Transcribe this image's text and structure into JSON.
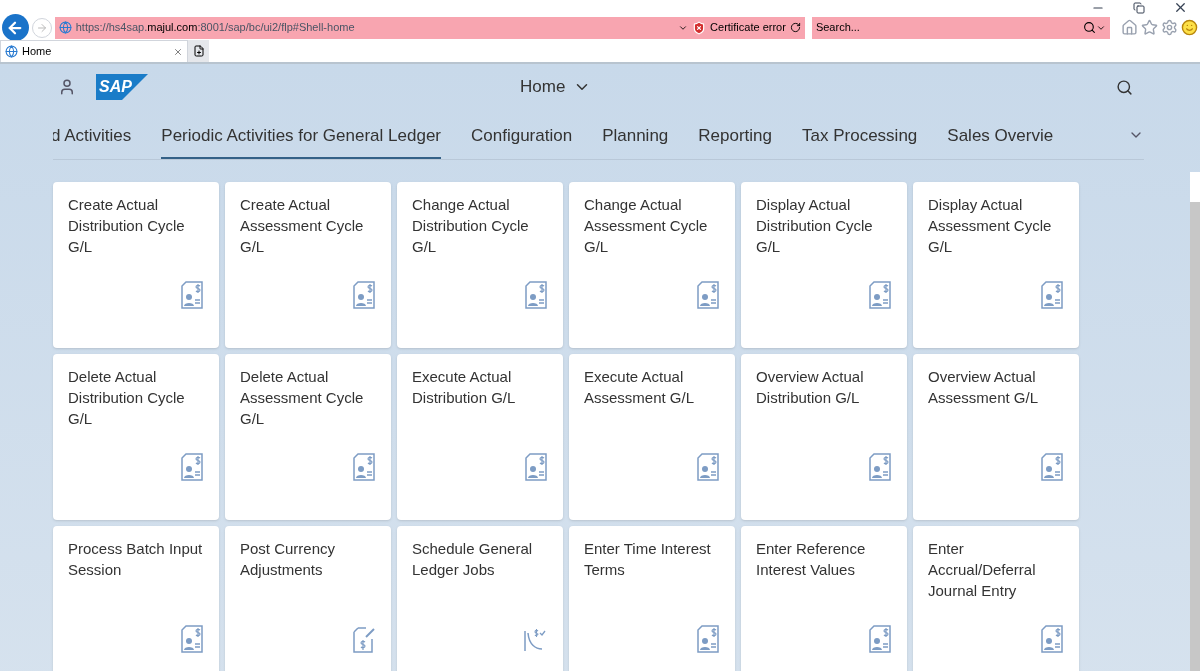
{
  "browser": {
    "url_prefix": "https://hs4sap.",
    "url_domain": "majul.com",
    "url_suffix": ":8001/sap/bc/ui2/flp#Shell-home",
    "certificate": "Certificate error",
    "search_placeholder": "Search...",
    "tab": "Home"
  },
  "shell": {
    "logo": "SAP",
    "title": "Home"
  },
  "tabs": [
    {
      "label": "d Activities",
      "selected": false
    },
    {
      "label": "Periodic Activities for General Ledger",
      "selected": true
    },
    {
      "label": "Configuration",
      "selected": false
    },
    {
      "label": "Planning",
      "selected": false
    },
    {
      "label": "Reporting",
      "selected": false
    },
    {
      "label": "Tax Processing",
      "selected": false
    },
    {
      "label": "Sales Overvie",
      "selected": false
    }
  ],
  "tiles": [
    {
      "title": "Create Actual Distribution Cycle G/L",
      "kind": "person"
    },
    {
      "title": "Create Actual Assessment Cycle G/L",
      "kind": "person"
    },
    {
      "title": "Change Actual Distribution Cycle G/L",
      "kind": "person"
    },
    {
      "title": "Change Actual Assessment Cycle G/L",
      "kind": "person"
    },
    {
      "title": "Display Actual Distribution Cycle G/L",
      "kind": "person"
    },
    {
      "title": "Display Actual Assessment Cycle G/L",
      "kind": "person"
    },
    {
      "title": "Delete Actual Distribution Cycle G/L",
      "kind": "person"
    },
    {
      "title": "Delete Actual Assessment Cycle G/L",
      "kind": "person"
    },
    {
      "title": "Execute Actual Distribution G/L",
      "kind": "person"
    },
    {
      "title": "Execute Actual Assessment G/L",
      "kind": "person"
    },
    {
      "title": "Overview Actual Distribution G/L",
      "kind": "person"
    },
    {
      "title": "Overview Actual Assessment G/L",
      "kind": "person"
    },
    {
      "title": "Process Batch Input Session",
      "kind": "person"
    },
    {
      "title": "Post Currency Adjustments",
      "kind": "edit"
    },
    {
      "title": "Schedule General Ledger Jobs",
      "kind": "chart"
    },
    {
      "title": "Enter Time Interest Terms",
      "kind": "person"
    },
    {
      "title": "Enter Reference Interest Values",
      "kind": "person"
    },
    {
      "title": "Enter Accrual/Deferral Journal Entry",
      "kind": "person"
    }
  ]
}
